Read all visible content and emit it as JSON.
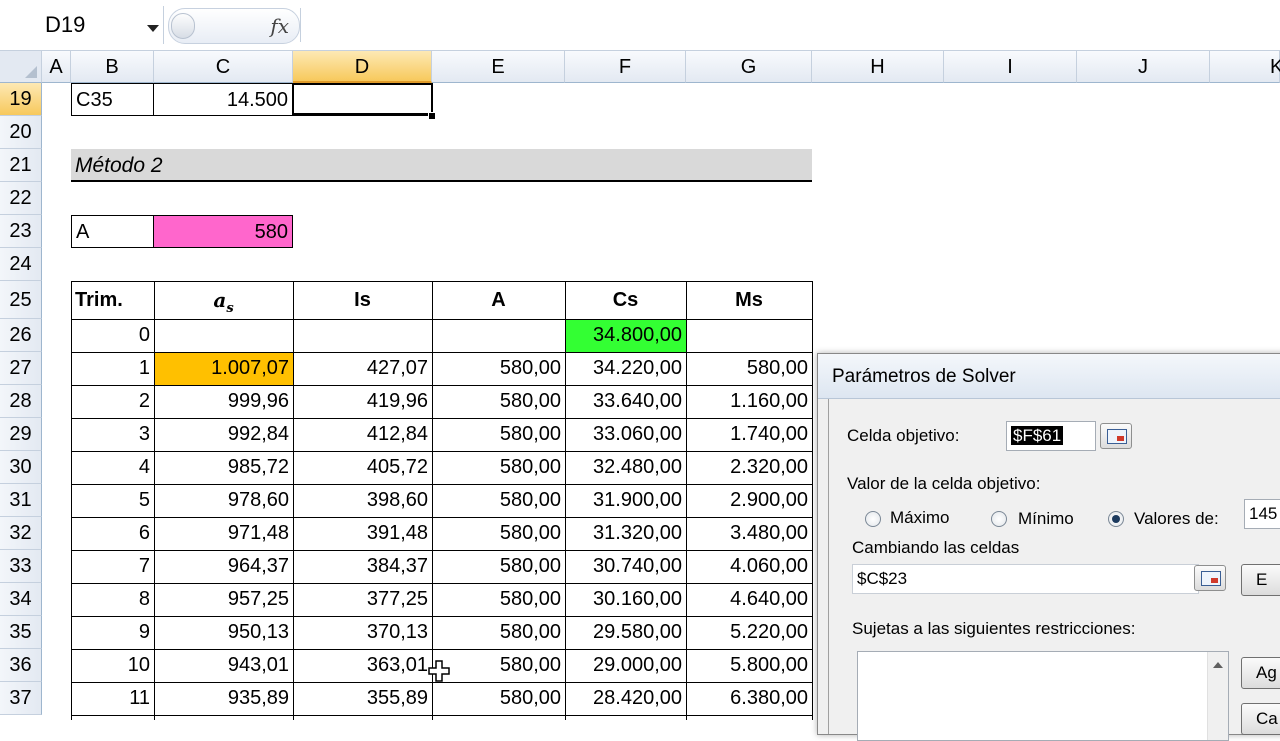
{
  "formula_bar": {
    "name_box": "D19",
    "fx_label": "fx",
    "formula": ""
  },
  "columns": [
    "A",
    "B",
    "C",
    "D",
    "E",
    "F",
    "G",
    "H",
    "I",
    "J",
    "K"
  ],
  "rows": [
    "19",
    "20",
    "21",
    "22",
    "23",
    "24",
    "25",
    "26",
    "27",
    "28",
    "29",
    "30",
    "31",
    "32",
    "33",
    "34",
    "35",
    "36",
    "37"
  ],
  "sheet": {
    "c35_label": "C35",
    "c35_value": "14.500",
    "method_title": "Método 2",
    "a_label": "A",
    "a_value": "580",
    "headers": {
      "trim": "Trim.",
      "as_main": "a",
      "as_sub": "s",
      "is": "Is",
      "a": "A",
      "cs": "Cs",
      "ms": "Ms"
    },
    "row0": {
      "trim": "0",
      "cs": "34.800,00"
    },
    "table": [
      {
        "trim": "1",
        "as": "1.007,07",
        "is": "427,07",
        "a": "580,00",
        "cs": "34.220,00",
        "ms": "580,00"
      },
      {
        "trim": "2",
        "as": "999,96",
        "is": "419,96",
        "a": "580,00",
        "cs": "33.640,00",
        "ms": "1.160,00"
      },
      {
        "trim": "3",
        "as": "992,84",
        "is": "412,84",
        "a": "580,00",
        "cs": "33.060,00",
        "ms": "1.740,00"
      },
      {
        "trim": "4",
        "as": "985,72",
        "is": "405,72",
        "a": "580,00",
        "cs": "32.480,00",
        "ms": "2.320,00"
      },
      {
        "trim": "5",
        "as": "978,60",
        "is": "398,60",
        "a": "580,00",
        "cs": "31.900,00",
        "ms": "2.900,00"
      },
      {
        "trim": "6",
        "as": "971,48",
        "is": "391,48",
        "a": "580,00",
        "cs": "31.320,00",
        "ms": "3.480,00"
      },
      {
        "trim": "7",
        "as": "964,37",
        "is": "384,37",
        "a": "580,00",
        "cs": "30.740,00",
        "ms": "4.060,00"
      },
      {
        "trim": "8",
        "as": "957,25",
        "is": "377,25",
        "a": "580,00",
        "cs": "30.160,00",
        "ms": "4.640,00"
      },
      {
        "trim": "9",
        "as": "950,13",
        "is": "370,13",
        "a": "580,00",
        "cs": "29.580,00",
        "ms": "5.220,00"
      },
      {
        "trim": "10",
        "as": "943,01",
        "is": "363,01",
        "a": "580,00",
        "cs": "29.000,00",
        "ms": "5.800,00"
      },
      {
        "trim": "11",
        "as": "935,89",
        "is": "355,89",
        "a": "580,00",
        "cs": "28.420,00",
        "ms": "6.380,00"
      }
    ]
  },
  "colors": {
    "pink": "#ff66cc",
    "green": "#33ff33",
    "orange": "#ffc000",
    "method_band": "#d9d9d9",
    "selected_header": "#f7c95c"
  },
  "solver": {
    "title": "Parámetros de Solver",
    "target_label": "Celda objetivo:",
    "target_value": "$F$61",
    "value_label": "Valor de la celda objetivo:",
    "max_label": "Máximo",
    "min_label": "Mínimo",
    "values_label": "Valores de:",
    "values_value": "145",
    "selected_option": "Valores de:",
    "changing_label": "Cambiando las celdas",
    "changing_value": "$C$23",
    "constraints_label": "Sujetas a las siguientes restricciones:",
    "btn_estimate": "E",
    "btn_add": "Ag",
    "btn_change": "Ca"
  }
}
